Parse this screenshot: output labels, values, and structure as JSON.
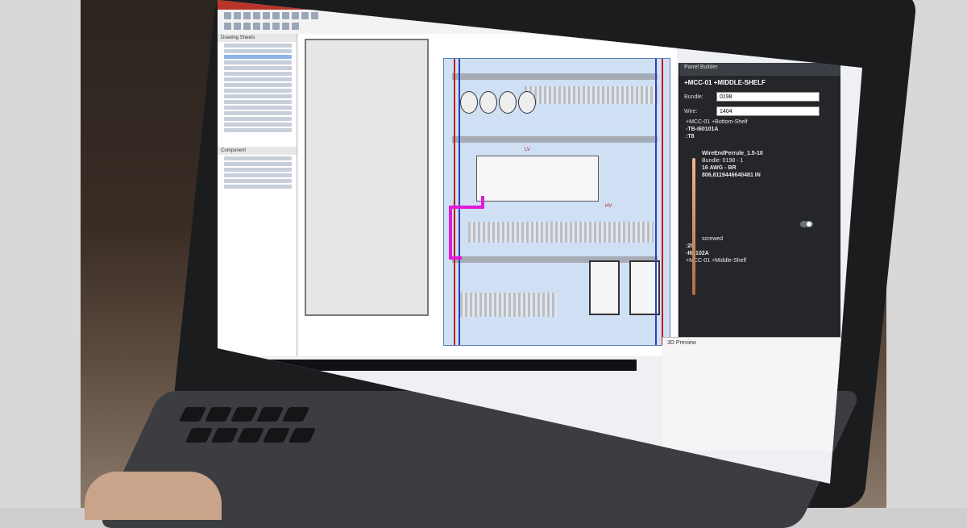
{
  "scene": {
    "left_tree_title": "Drawing Sheets",
    "component_title": "Component",
    "right_panel": {
      "header": "Panel Builder",
      "title": "+MCC-01 +MIDDLE-SHELF",
      "bundle_label": "Bundle:",
      "bundle_value": "0198",
      "wire_label": "Wire:",
      "wire_value": "1404",
      "line1": "+MCC-01 +Bottom-Shelf",
      "line2": "-TB-I60101A",
      "line3": ":T8",
      "line4": "WireEndFerrule_1.5-10",
      "line5": "Bundle: 0198 - 1",
      "line6": "16 AWG - BR",
      "line7": "806,8119446640481 IN",
      "line8": "screwed",
      "line9": ":20",
      "line10": "-I60102A",
      "line11": "+MCC-01 +Middle-Shelf"
    },
    "preview_title": "3D Preview",
    "labels": {
      "lv": "LV",
      "hv": "HV"
    },
    "colors": {
      "titlebar": "#b7342b",
      "highlight_wire": "#e21ad6",
      "panel_bg": "#cfe0f5"
    }
  }
}
